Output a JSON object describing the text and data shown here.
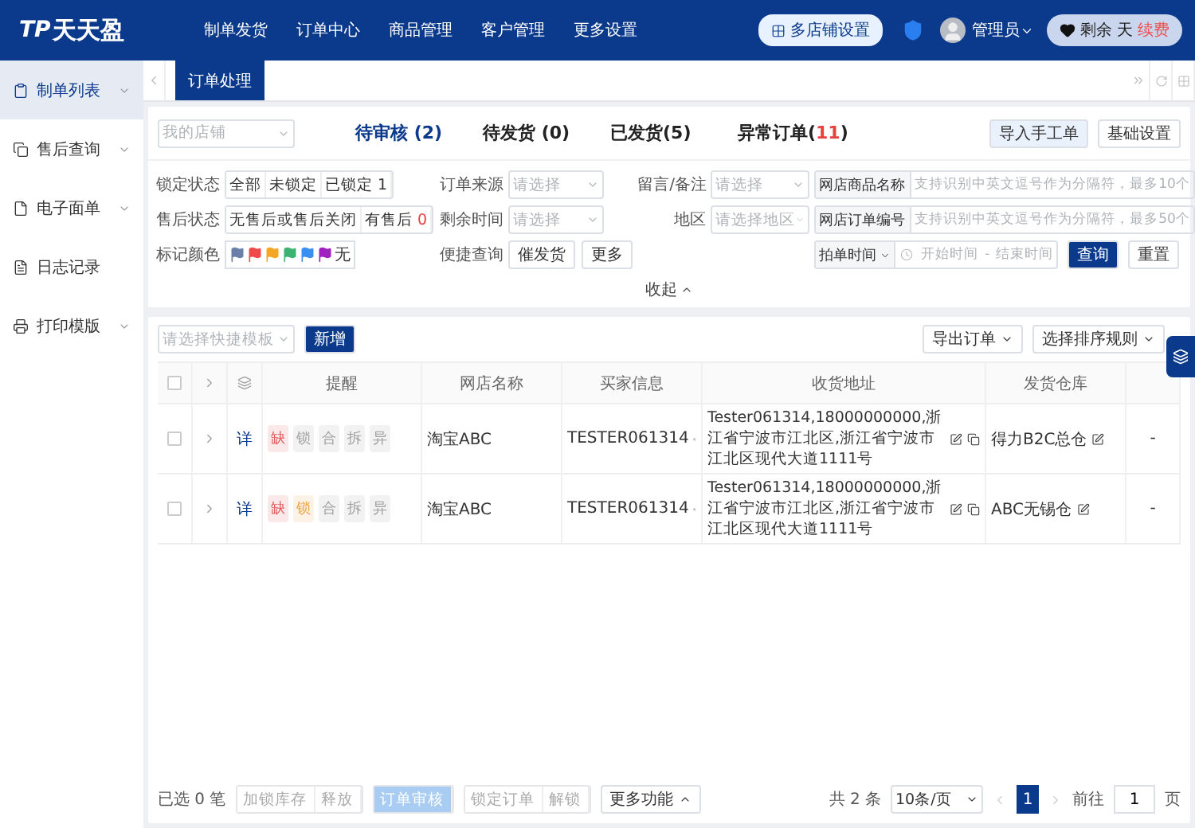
{
  "header": {
    "logo_mark": "TP",
    "logo": "天天盈",
    "nav": [
      "制单发货",
      "订单中心",
      "商品管理",
      "客户管理",
      "更多设置"
    ],
    "shop_button": "多店铺设置",
    "user": "管理员",
    "remaining": {
      "prefix": "剩余",
      "suffix": "天",
      "renew": "续费"
    }
  },
  "sidebar": [
    {
      "label": "制单列表",
      "selected": true,
      "expandable": true
    },
    {
      "label": "售后查询",
      "selected": false,
      "expandable": true
    },
    {
      "label": "电子面单",
      "selected": false,
      "expandable": true
    },
    {
      "label": "日志记录",
      "selected": false,
      "expandable": false
    },
    {
      "label": "打印模版",
      "selected": false,
      "expandable": true
    }
  ],
  "page_tabs": [
    {
      "label": "订单处理",
      "selected": true
    }
  ],
  "status_bar": {
    "shop_select": {
      "placeholder": "我的店铺"
    },
    "tabs": [
      {
        "label": "待审核 (",
        "count": "2",
        "tail": ")",
        "alert": false,
        "selected": true
      },
      {
        "label": "待发货 (",
        "count": "0",
        "tail": ")",
        "alert": false,
        "selected": false
      },
      {
        "label": "已发货(",
        "count": "5",
        "tail": ")",
        "alert": false,
        "selected": false
      },
      {
        "label": "异常订单(",
        "count": "11",
        "tail": ")",
        "alert": true,
        "selected": false
      }
    ],
    "actions": [
      {
        "label": "导入手工单",
        "kind": "highlight"
      },
      {
        "label": "基础设置",
        "kind": "plain"
      }
    ]
  },
  "filters": {
    "lock": {
      "label": "锁定状态",
      "options": [
        {
          "label": "全部"
        },
        {
          "label": "未锁定"
        },
        {
          "label": "已锁定",
          "count": "1",
          "alert": false
        }
      ]
    },
    "after_sale": {
      "label": "售后状态",
      "options": [
        {
          "label": "无售后或售后关闭"
        },
        {
          "label": "有售后",
          "count": "0",
          "alert": true
        }
      ]
    },
    "flags": {
      "label": "标记颜色",
      "items": [
        {
          "color": "#6b7fa8"
        },
        {
          "color": "#f04a4a"
        },
        {
          "color": "#f5a623"
        },
        {
          "color": "#3cb371"
        },
        {
          "color": "#3b8ff0"
        },
        {
          "color": "#a020c0"
        }
      ],
      "none": "无"
    },
    "source": {
      "label": "订单来源",
      "placeholder": "请选择"
    },
    "remaining_time": {
      "label": "剩余时间",
      "placeholder": "请选择"
    },
    "quick": {
      "label": "便捷查询",
      "options": [
        "催发货",
        "更多"
      ]
    },
    "remark": {
      "label": "留言/备注",
      "placeholder": "请选择"
    },
    "region": {
      "label": "地区",
      "placeholder": "请选择地区"
    },
    "product": {
      "field": "网店商品名称",
      "placeholder": "支持识别中英文逗号作为分隔符，最多10个"
    },
    "order_no": {
      "field": "网店订单编号",
      "placeholder": "支持识别中英文逗号作为分隔符，最多50个"
    },
    "time": {
      "field": "拍单时间",
      "start": "开始时间",
      "separator": "-",
      "end": "结束时间"
    },
    "search": "查询",
    "reset": "重置",
    "collapse": "收起"
  },
  "table": {
    "select_all_checked": false,
    "template": {
      "placeholder": "请选择快捷模板"
    },
    "add": "新增",
    "export": "导出订单",
    "sort": "选择排序规则",
    "columns": [
      "提醒",
      "网店名称",
      "买家信息",
      "收货地址",
      "发货仓库"
    ],
    "rows": [
      {
        "checked": false,
        "detail": "详",
        "tags": [
          {
            "label": "缺",
            "color": "#e05a5a"
          },
          {
            "label": "锁",
            "color": "#a0a0a0"
          },
          {
            "label": "合",
            "color": "#a0a0a0"
          },
          {
            "label": "拆",
            "color": "#a0a0a0"
          },
          {
            "label": "异",
            "color": "#a0a0a0"
          }
        ],
        "shop": "淘宝ABC",
        "buyer": "TESTER061314",
        "address": "Tester061314,18000000000,浙江省宁波市江北区,浙江省宁波市江北区现代大道1111号",
        "warehouse": "得力B2C总仓",
        "extra": "-"
      },
      {
        "checked": false,
        "detail": "详",
        "tags": [
          {
            "label": "缺",
            "color": "#e05a5a"
          },
          {
            "label": "锁",
            "color": "#f0a040"
          },
          {
            "label": "合",
            "color": "#a0a0a0"
          },
          {
            "label": "拆",
            "color": "#a0a0a0"
          },
          {
            "label": "异",
            "color": "#a0a0a0"
          }
        ],
        "shop": "淘宝ABC",
        "buyer": "TESTER061314",
        "address": "Tester061314,18000000000,浙江省宁波市江北区,浙江省宁波市江北区现代大道1111号",
        "warehouse": "ABC无锡仓",
        "extra": "-"
      }
    ]
  },
  "footer": {
    "selected": "已选 0 笔",
    "groups": [
      [
        {
          "label": "加锁库存",
          "kind": "plain"
        },
        {
          "label": "释放",
          "kind": "plain"
        }
      ],
      [
        {
          "label": "订单审核",
          "kind": "primary"
        }
      ],
      [
        {
          "label": "锁定订单",
          "kind": "plain"
        },
        {
          "label": "解锁",
          "kind": "plain"
        }
      ]
    ],
    "more": "更多功能",
    "total": "共 2 条",
    "page_size": "10条/页",
    "pages": [
      {
        "label": "1",
        "selected": true
      }
    ],
    "goto": {
      "label": "前往",
      "value": "1",
      "unit": "页"
    }
  }
}
